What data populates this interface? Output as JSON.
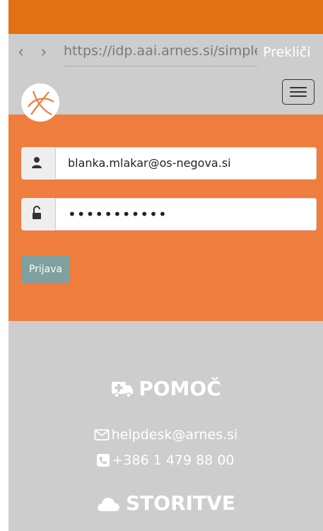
{
  "browser": {
    "back_icon": "chevron-left-icon",
    "forward_icon": "chevron-right-icon",
    "url": "https://idp.aai.arnes.si/simplesaml",
    "cancel_label": "Prekliči"
  },
  "navbar": {
    "logo_icon": "arnes-logo-icon",
    "menu_icon": "hamburger-menu-icon"
  },
  "login": {
    "username_icon": "user-icon",
    "username_value": "blanka.mlakar@os-negova.si",
    "password_icon": "unlock-icon",
    "password_value": "•••••••••••",
    "submit_label": "Prijava"
  },
  "help": {
    "heading": "POMOČ",
    "heading_icon": "ambulance-icon",
    "email_icon": "envelope-icon",
    "email": "helpdesk@arnes.si",
    "phone_icon": "phone-icon",
    "phone": "+386 1 479 88 00"
  },
  "services": {
    "heading": "STORITVE",
    "heading_icon": "cloud-icon"
  },
  "colors": {
    "status_bar": "#e17112",
    "login_panel": "#ef7d3d",
    "background": "#cdcdcd",
    "button": "#7ea0a0"
  }
}
